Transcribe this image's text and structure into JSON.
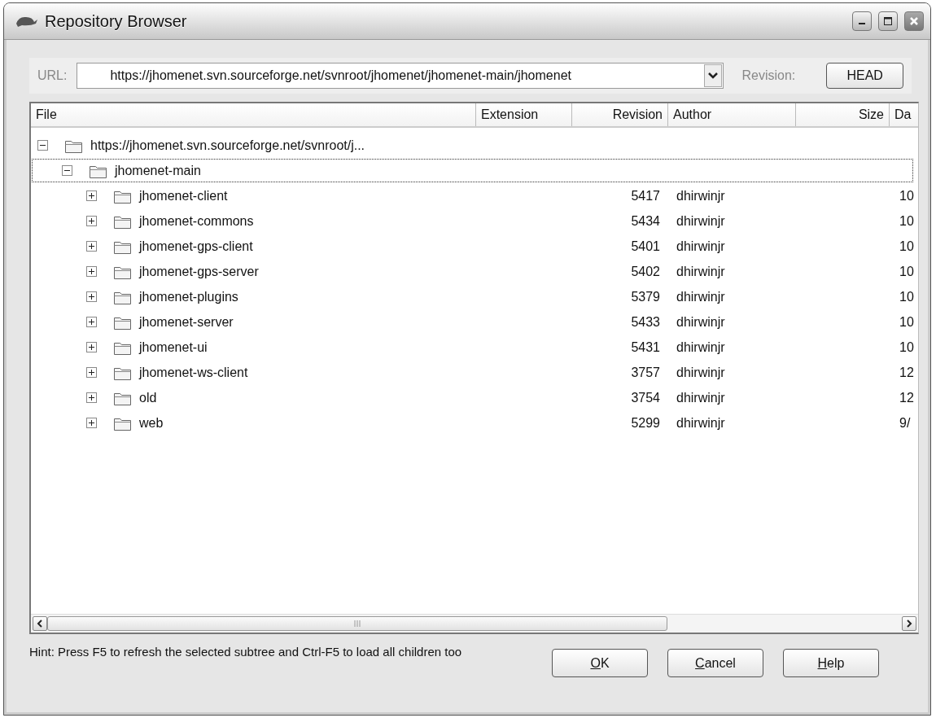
{
  "window": {
    "title": "Repository Browser"
  },
  "url": {
    "label": "URL:",
    "value": "https://jhomenet.svn.sourceforge.net/svnroot/jhomenet/jhomenet-main/jhomenet"
  },
  "revision": {
    "label": "Revision:",
    "button": "HEAD"
  },
  "table": {
    "columns": [
      "File",
      "Extension",
      "Revision",
      "Author",
      "Size",
      "Da"
    ],
    "rows": [
      {
        "name": "https://jhomenet.svn.sourceforge.net/svnroot/j...",
        "expanded": true,
        "focused": false,
        "children": [
          {
            "name": "jhomenet-main",
            "expanded": true,
            "focused": true,
            "children": [
              {
                "name": "jhomenet-client",
                "expanded": false,
                "focused": false,
                "revision": "5417",
                "author": "dhirwinjr",
                "date": "10"
              },
              {
                "name": "jhomenet-commons",
                "expanded": false,
                "focused": false,
                "revision": "5434",
                "author": "dhirwinjr",
                "date": "10"
              },
              {
                "name": "jhomenet-gps-client",
                "expanded": false,
                "focused": false,
                "revision": "5401",
                "author": "dhirwinjr",
                "date": "10"
              },
              {
                "name": "jhomenet-gps-server",
                "expanded": false,
                "focused": false,
                "revision": "5402",
                "author": "dhirwinjr",
                "date": "10"
              },
              {
                "name": "jhomenet-plugins",
                "expanded": false,
                "focused": false,
                "revision": "5379",
                "author": "dhirwinjr",
                "date": "10"
              },
              {
                "name": "jhomenet-server",
                "expanded": false,
                "focused": false,
                "revision": "5433",
                "author": "dhirwinjr",
                "date": "10"
              },
              {
                "name": "jhomenet-ui",
                "expanded": false,
                "focused": false,
                "revision": "5431",
                "author": "dhirwinjr",
                "date": "10"
              },
              {
                "name": "jhomenet-ws-client",
                "expanded": false,
                "focused": false,
                "revision": "3757",
                "author": "dhirwinjr",
                "date": "12"
              },
              {
                "name": "old",
                "expanded": false,
                "focused": false,
                "revision": "3754",
                "author": "dhirwinjr",
                "date": "12"
              },
              {
                "name": "web",
                "expanded": false,
                "focused": false,
                "revision": "5299",
                "author": "dhirwinjr",
                "date": "9/"
              }
            ]
          }
        ]
      }
    ]
  },
  "hint": "Hint: Press F5 to refresh the selected subtree and Ctrl-F5 to load all children too",
  "buttons": [
    "OK",
    "Cancel",
    "Help"
  ]
}
